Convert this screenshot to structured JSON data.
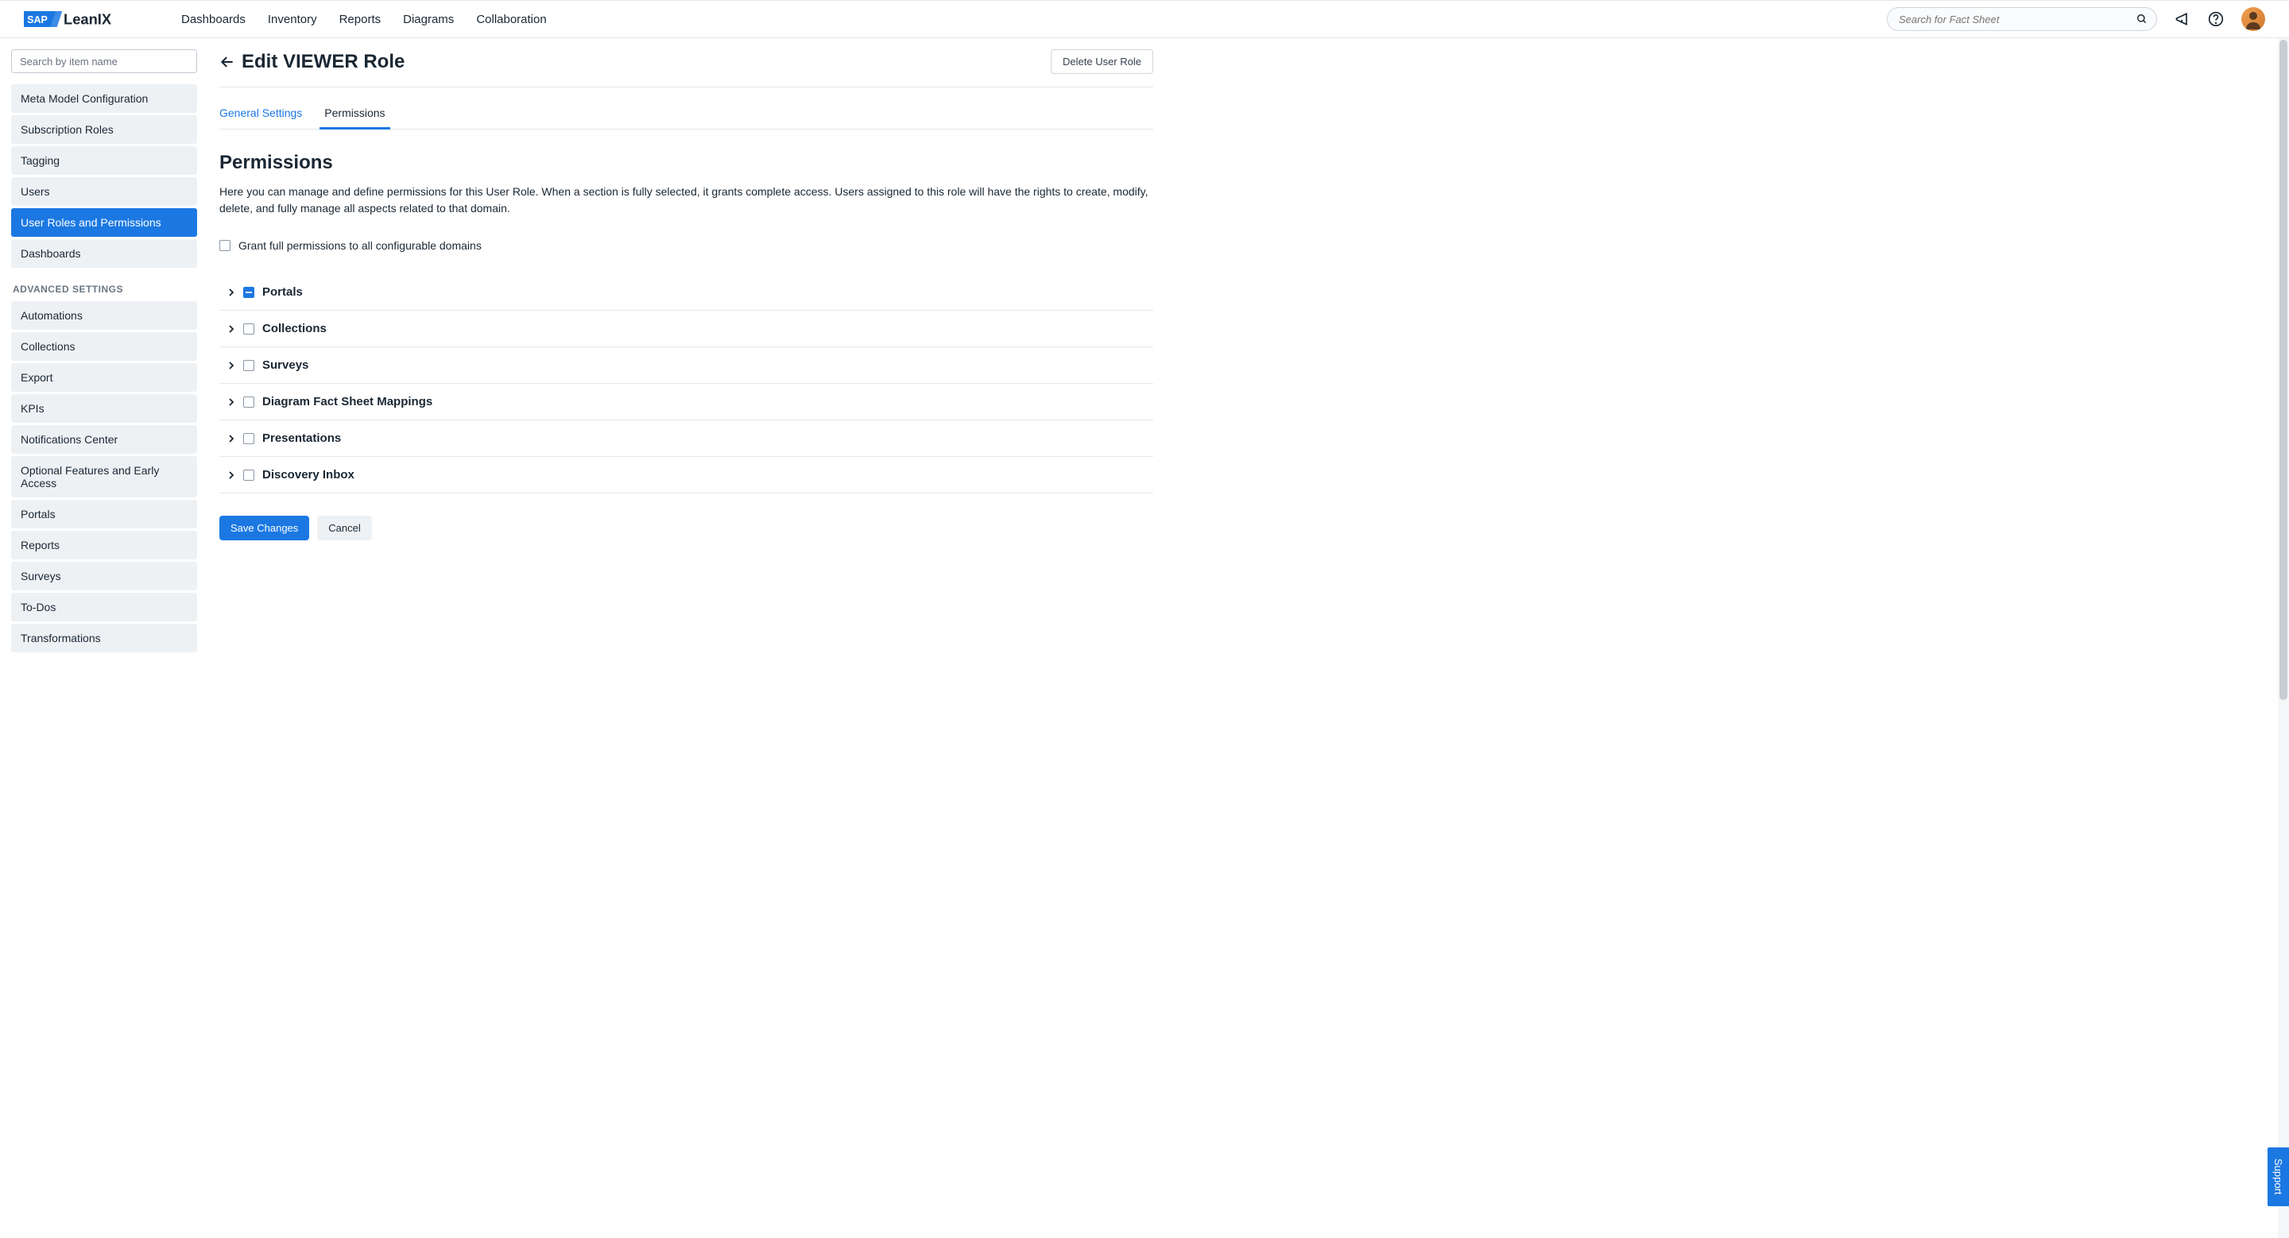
{
  "topnav": {
    "items": [
      "Dashboards",
      "Inventory",
      "Reports",
      "Diagrams",
      "Collaboration"
    ]
  },
  "search": {
    "placeholder": "Search for Fact Sheet"
  },
  "sidebar": {
    "search_placeholder": "Search by item name",
    "group1": [
      "Meta Model Configuration",
      "Subscription Roles",
      "Tagging",
      "Users",
      "User Roles and Permissions",
      "Dashboards"
    ],
    "advanced_header": "ADVANCED SETTINGS",
    "group2": [
      "Automations",
      "Collections",
      "Export",
      "KPIs",
      "Notifications Center",
      "Optional Features and Early Access",
      "Portals",
      "Reports",
      "Surveys",
      "To-Dos",
      "Transformations"
    ]
  },
  "page": {
    "title": "Edit VIEWER Role",
    "delete": "Delete User Role"
  },
  "tabs": {
    "general": "General Settings",
    "permissions": "Permissions"
  },
  "perms": {
    "heading": "Permissions",
    "desc": "Here you can manage and define permissions for this User Role. When a section is fully selected, it grants complete access. Users assigned to this role will have the rights to create, modify, delete, and fully manage all aspects related to that domain.",
    "grant_all": "Grant full permissions to all configurable domains",
    "groups": [
      {
        "label": "Portals",
        "state": "indeterminate"
      },
      {
        "label": "Collections",
        "state": "unchecked"
      },
      {
        "label": "Surveys",
        "state": "unchecked"
      },
      {
        "label": "Diagram Fact Sheet Mappings",
        "state": "unchecked"
      },
      {
        "label": "Presentations",
        "state": "unchecked"
      },
      {
        "label": "Discovery Inbox",
        "state": "unchecked"
      }
    ]
  },
  "actions": {
    "save": "Save Changes",
    "cancel": "Cancel"
  },
  "support": "Support"
}
